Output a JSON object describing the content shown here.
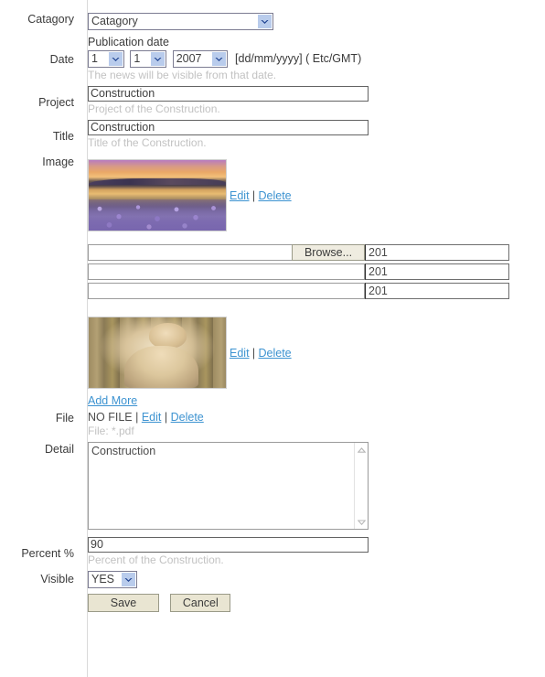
{
  "form": {
    "rows": {
      "category": {
        "label": "Catagory",
        "select_value": "Catagory"
      },
      "date": {
        "label": "Date",
        "title": "Publication date",
        "day": "1",
        "month": "1",
        "year": "2007",
        "format_note": "[dd/mm/yyyy] ( Etc/GMT)",
        "hint": "The news will be visible from that date."
      },
      "project": {
        "label": "Project",
        "value": "Construction",
        "hint": "Project of the Construction."
      },
      "title": {
        "label": "Title",
        "value": "Construction",
        "hint": "Title of the Construction."
      },
      "image": {
        "label": "Image",
        "first_thumb_alt": "sunset-lake-lupine-photo",
        "second_thumb_alt": "golden-portrait-photo",
        "edit_link": "Edit",
        "separator": "|",
        "delete_link": "Delete",
        "add_more_link": "Add More",
        "browse_button": "Browse...",
        "upload_field_value": "",
        "size_rows": [
          "201",
          "201",
          "201"
        ]
      },
      "file": {
        "label": "File",
        "status": "NO FILE",
        "separator": "|",
        "edit_link": "Edit",
        "delete_link": "Delete",
        "hint": "File: *.pdf"
      },
      "detail": {
        "label": "Detail",
        "value": "Construction"
      },
      "percent": {
        "label": "Percent %",
        "value": "90",
        "hint": "Percent of the Construction."
      },
      "visible": {
        "label": "Visible",
        "select_value": "YES"
      }
    },
    "actions": {
      "save": "Save",
      "cancel": "Cancel"
    }
  },
  "colors": {
    "link": "#3d93d1",
    "hint": "#c2c2c2",
    "button_bg": "#e9e5d2",
    "select_arrow_bg": "#b9ccec",
    "divider": "#d9d9d9"
  }
}
